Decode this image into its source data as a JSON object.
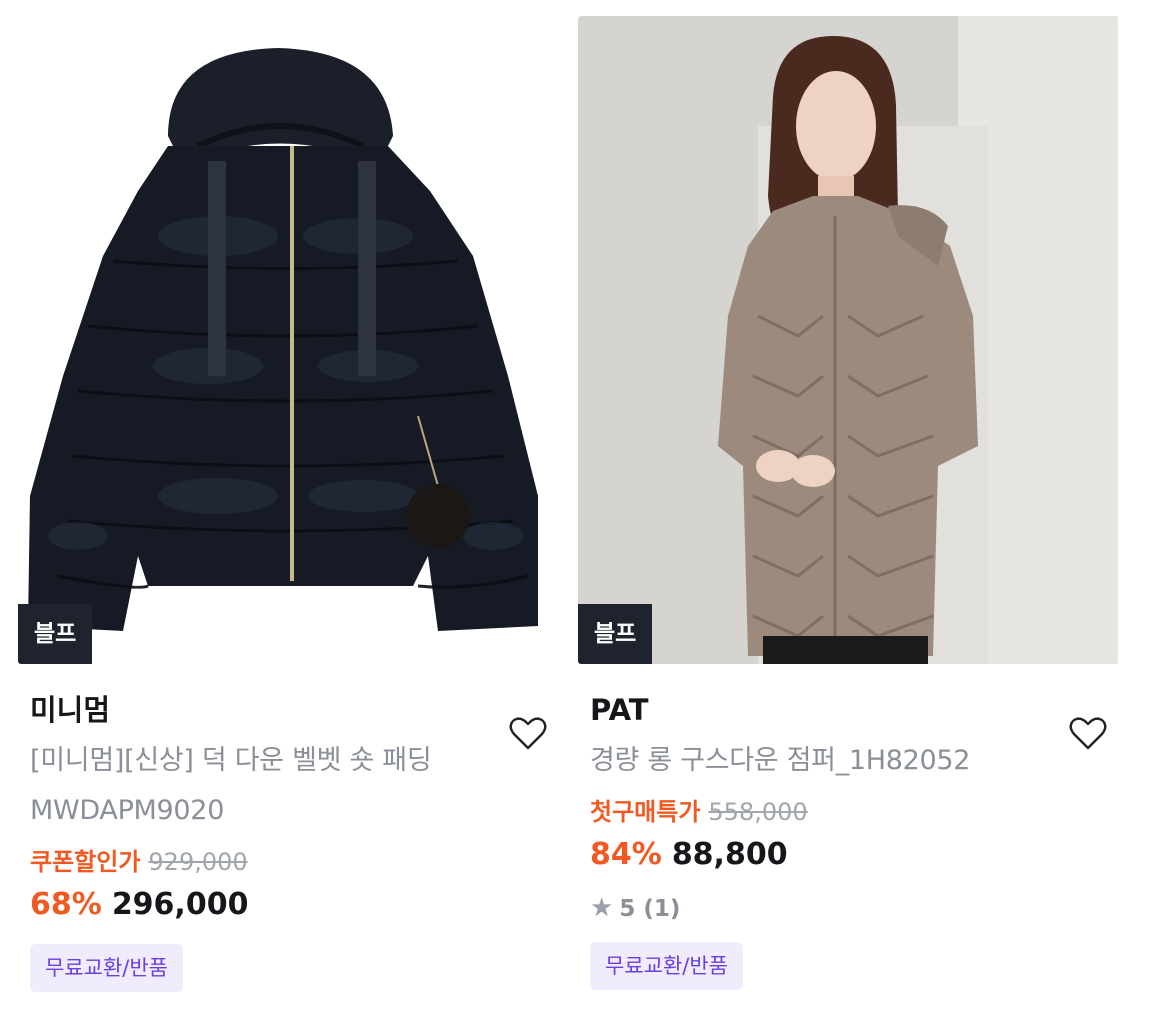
{
  "products": [
    {
      "badge": "블프",
      "brand": "미니멈",
      "name_line1": "[미니멈][신상] 덕 다운 벨벳 숏 패딩",
      "name_line2": "MWDAPM9020",
      "sale_label": "쿠폰할인가",
      "original_price": "929,000",
      "discount_rate": "68%",
      "price": "296,000",
      "tag": "무료교환/반품",
      "image_icon": "black-velvet-puffer-jacket"
    },
    {
      "badge": "블프",
      "brand": "PAT",
      "name_line1": "경량 롱 구스다운 점퍼_1H82052",
      "sale_label": "첫구매특가",
      "original_price": "558,000",
      "discount_rate": "84%",
      "price": "88,800",
      "rating_score": "5",
      "rating_count": "(1)",
      "tag": "무료교환/반품",
      "image_icon": "model-in-beige-long-down-coat"
    }
  ],
  "colors": {
    "sale": "#f05a22",
    "badge_bg": "#1f232d",
    "tag_bg": "#f1ecfd",
    "tag_text": "#6b3fe0"
  }
}
